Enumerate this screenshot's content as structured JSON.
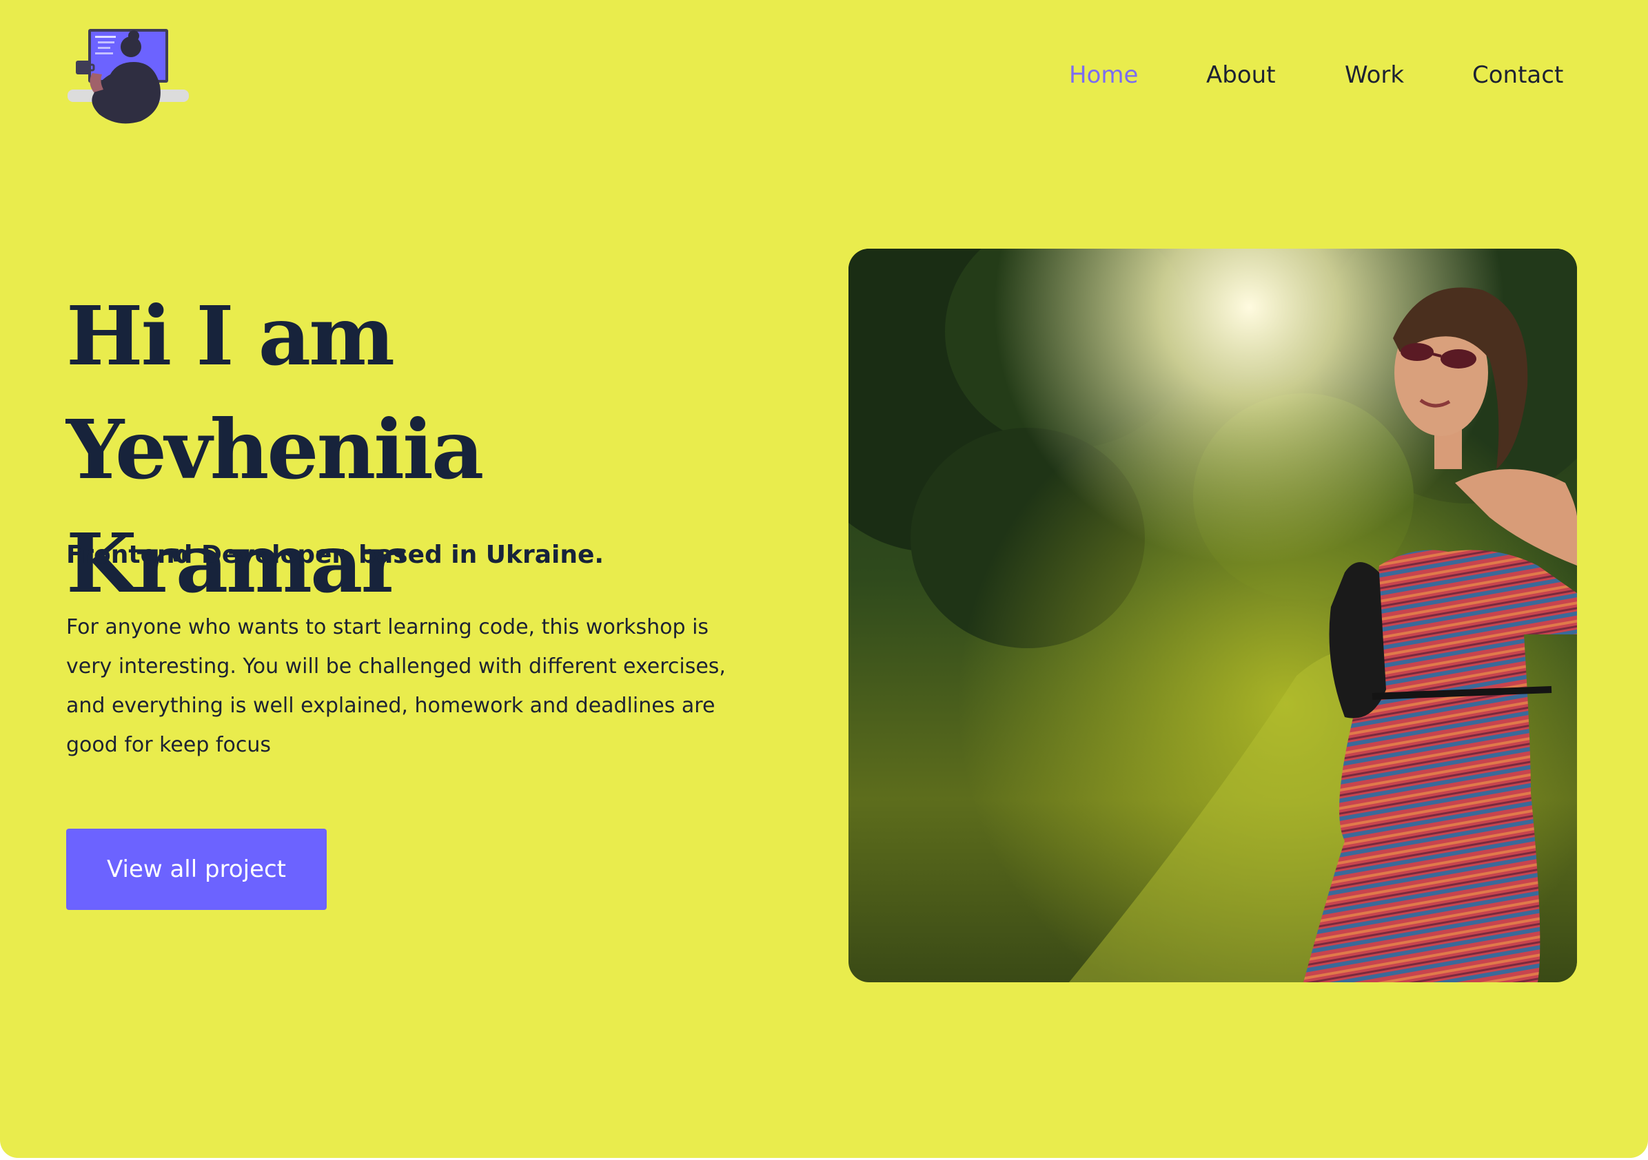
{
  "header": {
    "logo_icon": "developer-at-laptop-illustration",
    "nav": [
      {
        "label": "Home",
        "active": true
      },
      {
        "label": "About",
        "active": false
      },
      {
        "label": "Work",
        "active": false
      },
      {
        "label": "Contact",
        "active": false
      }
    ]
  },
  "hero": {
    "title_line1": "Hi I am Yevheniia",
    "title_line2": "Kramar",
    "subtitle": "Frontend Developer, based in Ukraine.",
    "description": "For anyone who wants to start learning code, this workshop is very interesting. You will be challenged  with different exercises, and everything is well explained, homework and deadlines are good for keep focus",
    "cta_label": "View all project",
    "photo": "woman-in-sunlit-forest-photo"
  },
  "colors": {
    "background": "#e9ec4d",
    "text_dark": "#17233b",
    "accent": "#6c63ff",
    "nav_active": "#7c6cf2"
  }
}
